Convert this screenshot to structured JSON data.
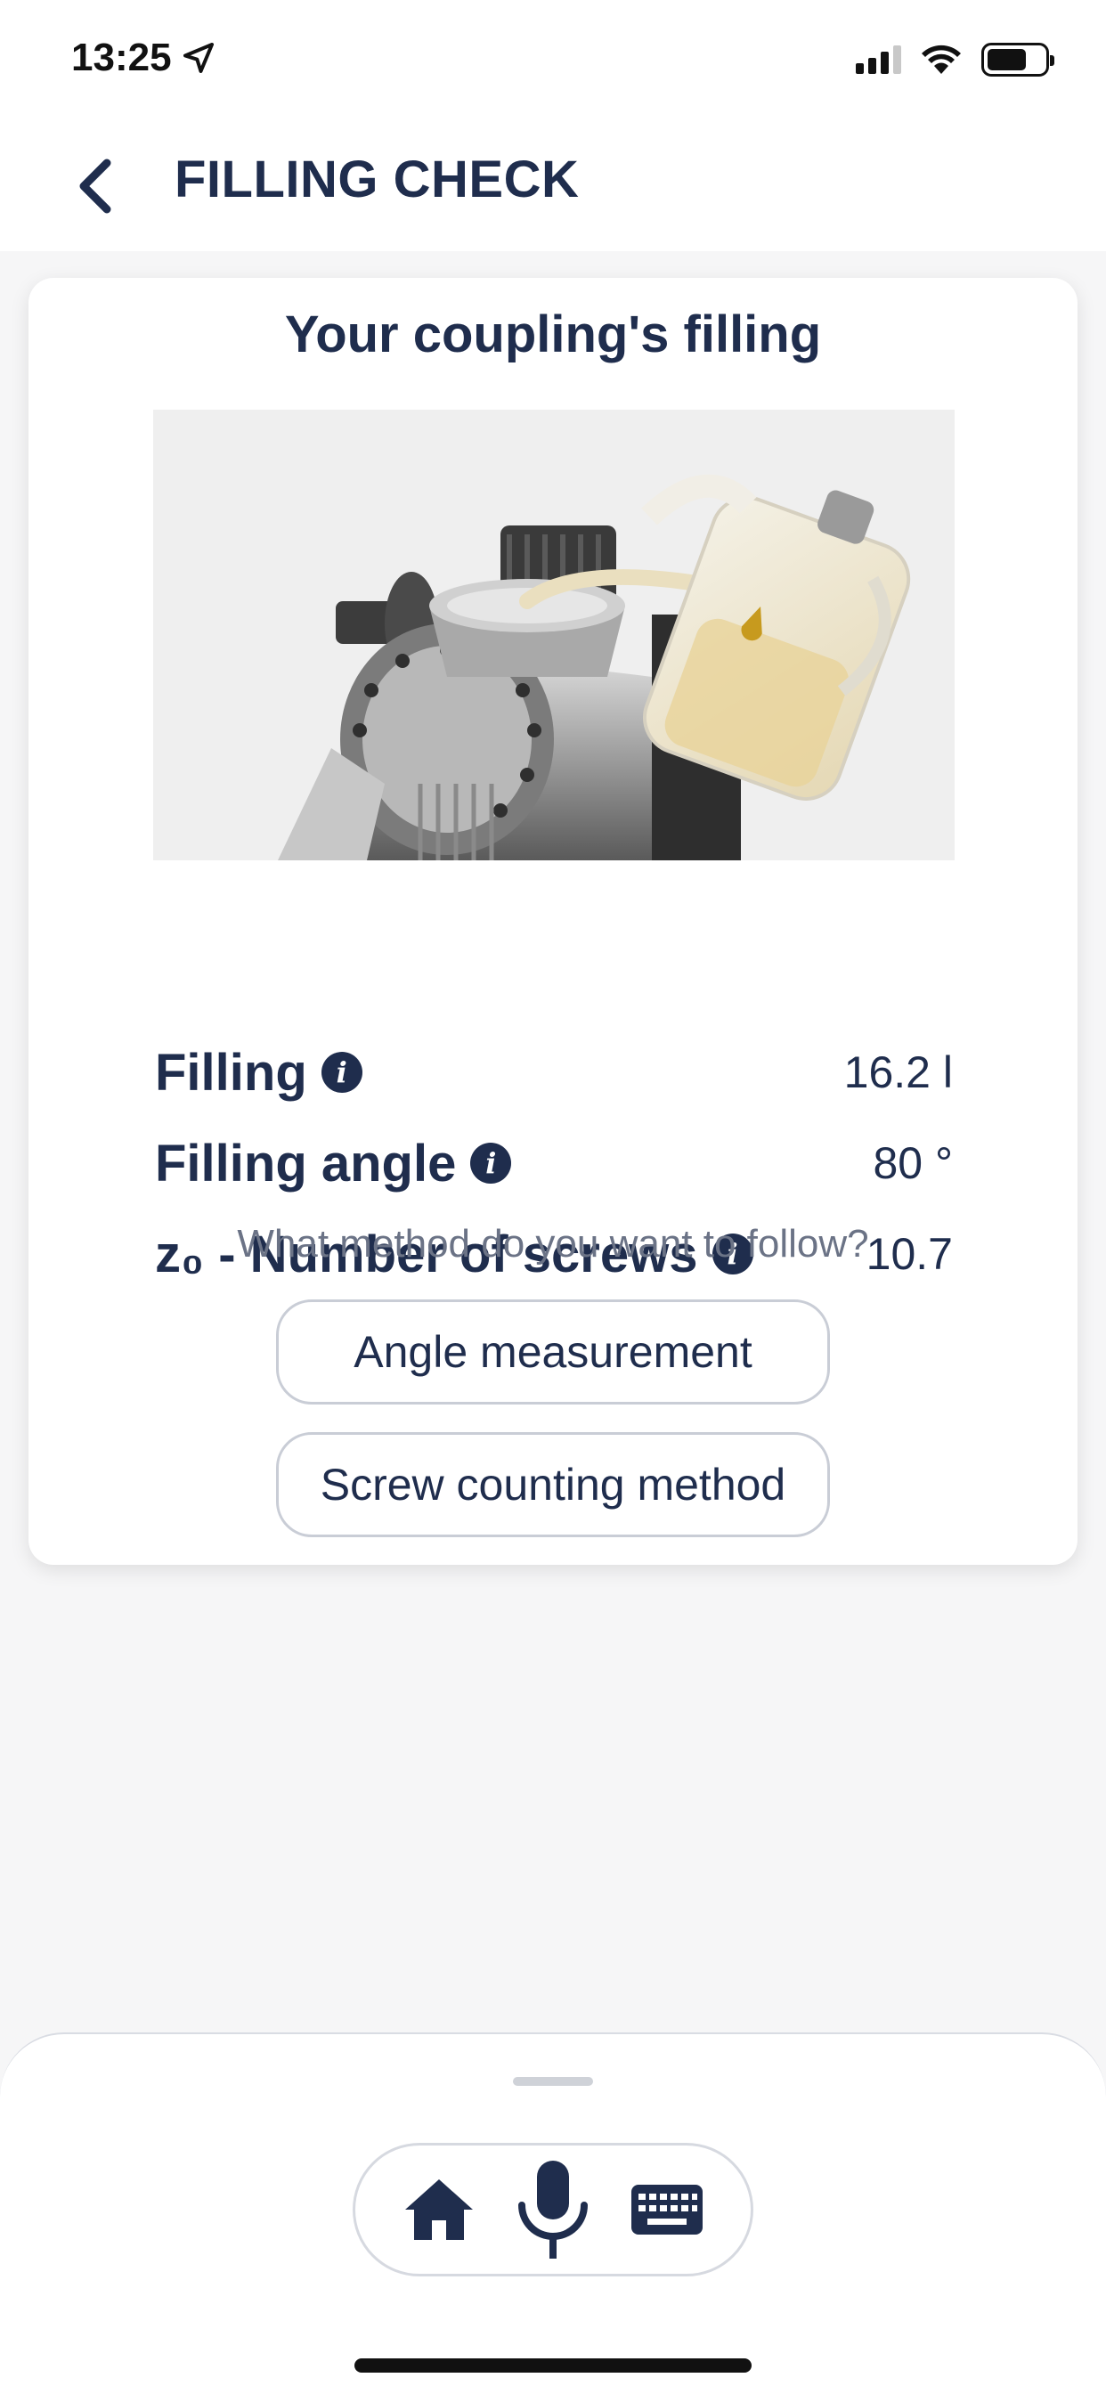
{
  "status_bar": {
    "time": "13:25",
    "location_icon": "location-arrow-icon",
    "signal_icon": "cellular-signal-icon",
    "wifi_icon": "wifi-icon",
    "battery_icon": "battery-icon"
  },
  "header": {
    "back_icon": "chevron-left-icon",
    "title": "FILLING CHECK"
  },
  "card": {
    "title": "Your coupling's filling",
    "illustration": "coupling-oil-filling-illustration",
    "rows": [
      {
        "label": "Filling",
        "value": "16.2 l"
      },
      {
        "label": "Filling angle",
        "value": "80 °"
      },
      {
        "label": "z₀ - Number of screws",
        "value": "10.7"
      }
    ],
    "info_icon_glyph": "i",
    "question": "What method do you want to follow?",
    "buttons": {
      "angle": "Angle measurement",
      "screw": "Screw counting method"
    }
  },
  "toolbar": {
    "icons": [
      "home-icon",
      "microphone-icon",
      "keyboard-icon"
    ]
  },
  "colors": {
    "primary": "#1f2d4d",
    "background": "#f6f6f7",
    "muted_text": "#6b7386",
    "border": "#c9cdd6"
  }
}
